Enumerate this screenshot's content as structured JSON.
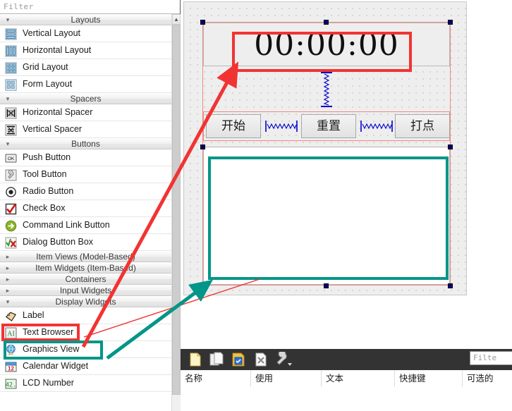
{
  "widget_box": {
    "filter": {
      "placeholder": "Filter"
    },
    "groups": [
      {
        "name": "Layouts",
        "expanded": true,
        "arrow": "chevron-down",
        "items": [
          {
            "label": "Vertical Layout",
            "icon": "vertical-layout-icon"
          },
          {
            "label": "Horizontal Layout",
            "icon": "horizontal-layout-icon"
          },
          {
            "label": "Grid Layout",
            "icon": "grid-layout-icon"
          },
          {
            "label": "Form Layout",
            "icon": "form-layout-icon"
          }
        ]
      },
      {
        "name": "Spacers",
        "expanded": true,
        "arrow": "chevron-down",
        "items": [
          {
            "label": "Horizontal Spacer",
            "icon": "horizontal-spacer-icon"
          },
          {
            "label": "Vertical Spacer",
            "icon": "vertical-spacer-icon"
          }
        ]
      },
      {
        "name": "Buttons",
        "expanded": true,
        "arrow": "chevron-down",
        "items": [
          {
            "label": "Push Button",
            "icon": "push-button-icon"
          },
          {
            "label": "Tool Button",
            "icon": "tool-button-icon"
          },
          {
            "label": "Radio Button",
            "icon": "radio-button-icon"
          },
          {
            "label": "Check Box",
            "icon": "check-box-icon"
          },
          {
            "label": "Command Link Button",
            "icon": "command-link-icon"
          },
          {
            "label": "Dialog Button Box",
            "icon": "dialog-button-box-icon"
          }
        ]
      },
      {
        "name": "Item Views (Model-Based)",
        "expanded": false,
        "arrow": "chevron-right",
        "items": []
      },
      {
        "name": "Item Widgets (Item-Based)",
        "expanded": false,
        "arrow": "chevron-right",
        "items": []
      },
      {
        "name": "Containers",
        "expanded": false,
        "arrow": "chevron-right",
        "items": []
      },
      {
        "name": "Input Widgets",
        "expanded": false,
        "arrow": "chevron-right",
        "items": []
      },
      {
        "name": "Display Widgets",
        "expanded": true,
        "arrow": "chevron-down",
        "items": [
          {
            "label": "Label",
            "icon": "label-icon",
            "highlight": "red"
          },
          {
            "label": "Text Browser",
            "icon": "text-browser-icon",
            "highlight": "teal"
          },
          {
            "label": "Graphics View",
            "icon": "graphics-view-icon"
          },
          {
            "label": "Calendar Widget",
            "icon": "calendar-widget-icon"
          },
          {
            "label": "LCD Number",
            "icon": "lcd-number-icon"
          }
        ]
      }
    ]
  },
  "form": {
    "lcd_text": "00:00:00",
    "buttons": [
      {
        "label": "开始"
      },
      {
        "label": "重置"
      },
      {
        "label": "打点"
      }
    ],
    "spacers": [
      {
        "type": "vertical-spacer"
      },
      {
        "type": "horizontal-spacer"
      },
      {
        "type": "horizontal-spacer"
      }
    ],
    "text_browser": {
      "content": ""
    }
  },
  "action_editor": {
    "toolbar": [
      {
        "name": "new-action-icon",
        "title": "New"
      },
      {
        "name": "copy-action-icon",
        "title": "Copy"
      },
      {
        "name": "paste-action-icon",
        "title": "Paste"
      },
      {
        "name": "delete-action-icon",
        "title": "Delete"
      },
      {
        "name": "configure-icon",
        "title": "Configure"
      }
    ],
    "filter": {
      "placeholder": "Filte"
    },
    "columns": [
      {
        "label": "名称"
      },
      {
        "label": "使用"
      },
      {
        "label": "文本"
      },
      {
        "label": "快捷键"
      },
      {
        "label": "可选的"
      }
    ],
    "rows": []
  },
  "annotations": {
    "red": {
      "color": "#f23333",
      "targets": [
        "lcd-number-widget",
        "label-entry"
      ]
    },
    "teal": {
      "color": "#009688",
      "targets": [
        "text-browser-widget",
        "text-browser-entry"
      ]
    }
  }
}
